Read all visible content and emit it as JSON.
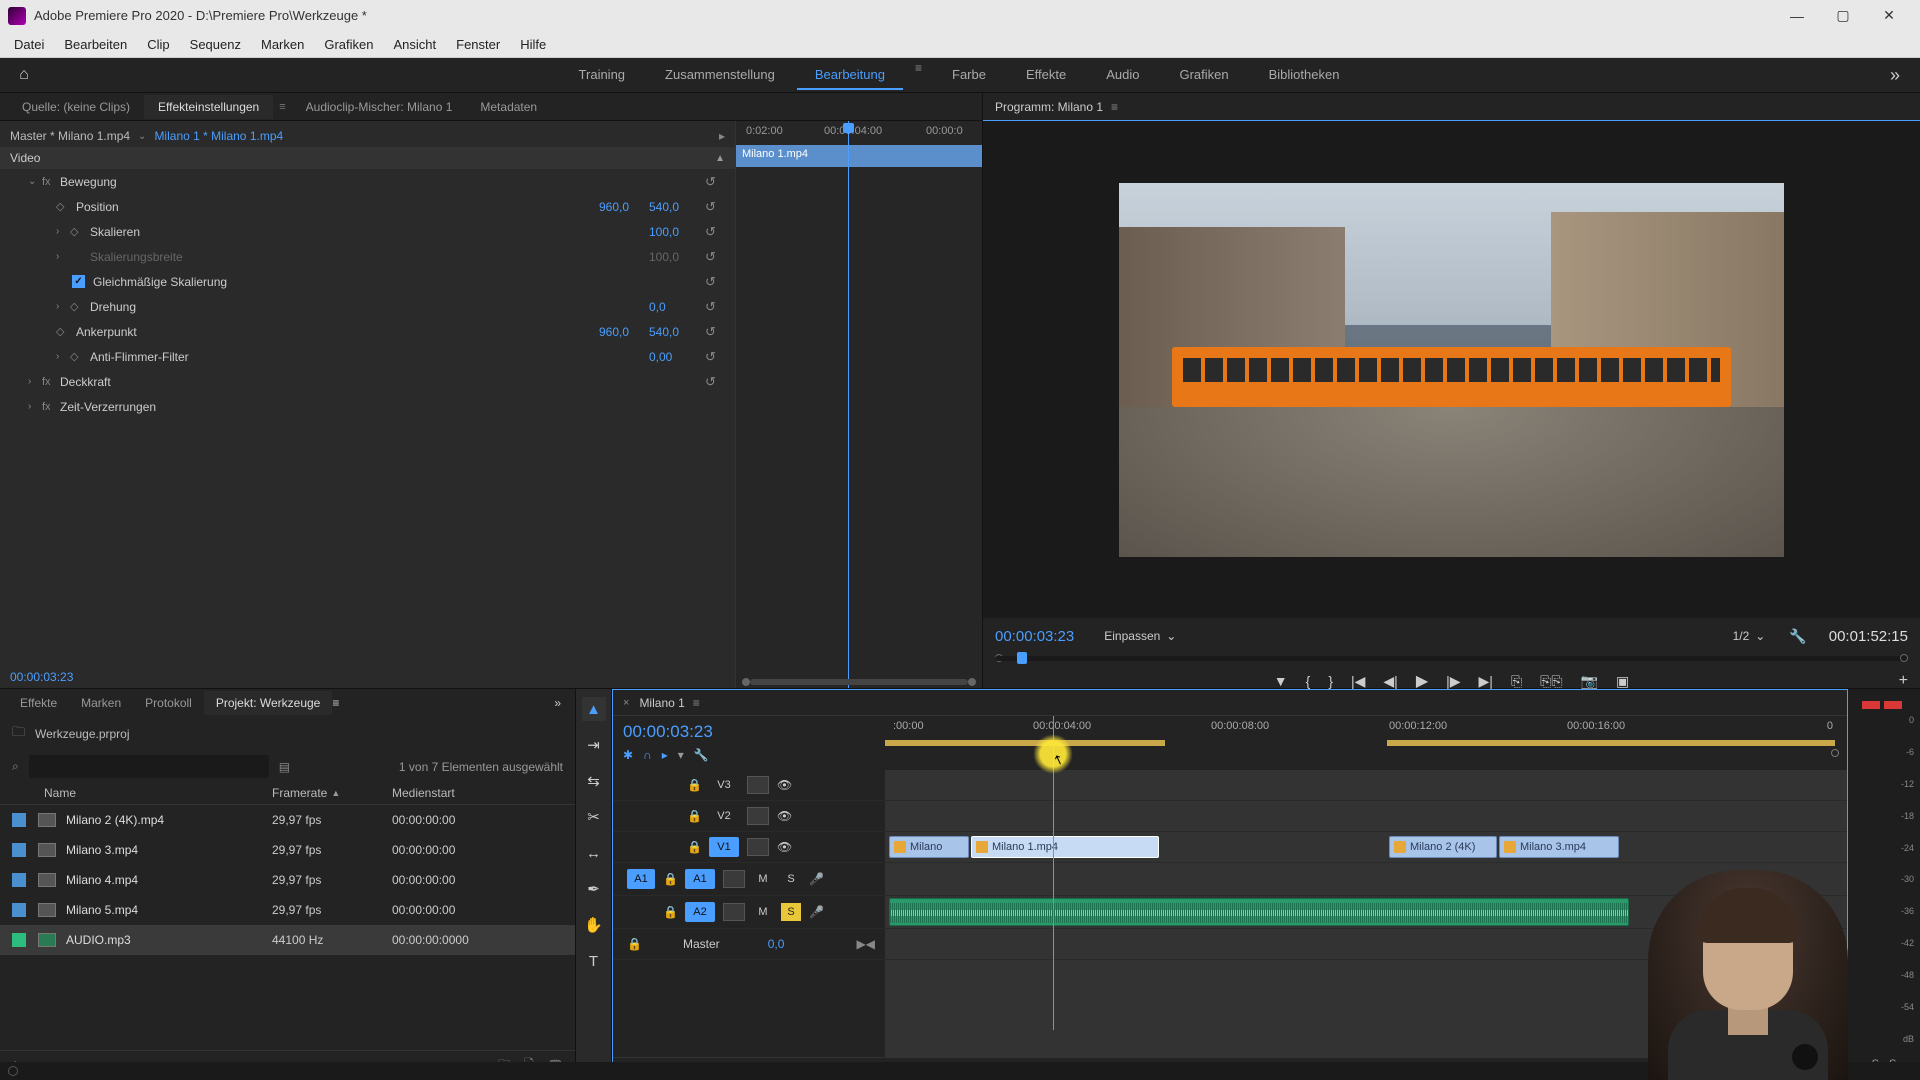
{
  "titlebar": {
    "app": "Adobe Premiere Pro 2020",
    "project_path": "D:\\Premiere Pro\\Werkzeuge *"
  },
  "menu": [
    "Datei",
    "Bearbeiten",
    "Clip",
    "Sequenz",
    "Marken",
    "Grafiken",
    "Ansicht",
    "Fenster",
    "Hilfe"
  ],
  "workspaces": {
    "tabs": [
      "Training",
      "Zusammenstellung",
      "Bearbeitung",
      "Farbe",
      "Effekte",
      "Audio",
      "Grafiken",
      "Bibliotheken"
    ],
    "active": "Bearbeitung"
  },
  "source_tabs": {
    "items": [
      "Quelle: (keine Clips)",
      "Effekteinstellungen",
      "Audioclip-Mischer: Milano 1",
      "Metadaten"
    ],
    "active": "Effekteinstellungen"
  },
  "effect_controls": {
    "master": "Master * Milano 1.mp4",
    "clipref": "Milano 1 * Milano 1.mp4",
    "section": "Video",
    "clip_label": "Milano 1.mp4",
    "ruler": [
      "0:02:00",
      "00:00:04:00",
      "00:00:0"
    ],
    "timecode": "00:00:03:23",
    "rows": {
      "bewegung": "Bewegung",
      "position": "Position",
      "pos_x": "960,0",
      "pos_y": "540,0",
      "skalieren": "Skalieren",
      "skal_v": "100,0",
      "skalbreite": "Skalierungsbreite",
      "skalb_v": "100,0",
      "gleich": "Gleichmäßige Skalierung",
      "drehung": "Drehung",
      "dreh_v": "0,0",
      "anker": "Ankerpunkt",
      "ank_x": "960,0",
      "ank_y": "540,0",
      "flimmer": "Anti-Flimmer-Filter",
      "flim_v": "0,00",
      "deckkraft": "Deckkraft",
      "zeit": "Zeit-Verzerrungen"
    }
  },
  "program": {
    "title": "Programm: Milano 1",
    "timecode": "00:00:03:23",
    "fit": "Einpassen",
    "resolution": "1/2",
    "duration": "00:01:52:15"
  },
  "project_panel": {
    "tabs": [
      "Effekte",
      "Marken",
      "Protokoll",
      "Projekt: Werkzeuge"
    ],
    "active": "Projekt: Werkzeuge",
    "filename": "Werkzeuge.prproj",
    "selection_info": "1 von 7 Elementen ausgewählt",
    "search_placeholder": "",
    "headers": {
      "name": "Name",
      "framerate": "Framerate",
      "mediastart": "Medienstart"
    },
    "items": [
      {
        "name": "Milano 2 (4K).mp4",
        "fr": "29,97 fps",
        "ms": "00:00:00:00",
        "type": "v"
      },
      {
        "name": "Milano 3.mp4",
        "fr": "29,97 fps",
        "ms": "00:00:00:00",
        "type": "v"
      },
      {
        "name": "Milano 4.mp4",
        "fr": "29,97 fps",
        "ms": "00:00:00:00",
        "type": "v"
      },
      {
        "name": "Milano 5.mp4",
        "fr": "29,97 fps",
        "ms": "00:00:00:00",
        "type": "v"
      },
      {
        "name": "AUDIO.mp3",
        "fr": "44100 Hz",
        "ms": "00:00:00:0000",
        "type": "a",
        "sel": true
      }
    ]
  },
  "timeline": {
    "seq_name": "Milano 1",
    "timecode": "00:00:03:23",
    "ruler": [
      ":00:00",
      "00:00:04:00",
      "00:00:08:00",
      "00:00:12:00",
      "00:00:16:00",
      "0"
    ],
    "tracks": {
      "v3": "V3",
      "v2": "V2",
      "v1": "V1",
      "a1": "A1",
      "a2": "A2",
      "master": "Master",
      "master_v": "0,0",
      "src_a1": "A1"
    },
    "clips": {
      "c1": "Milano",
      "c2": "Milano 1.mp4",
      "c3": "Milano 2 (4K)",
      "c4": "Milano 3.mp4"
    },
    "mute": "M",
    "solo": "S"
  },
  "meters": {
    "db": [
      "0",
      "-6",
      "-12",
      "-18",
      "-24",
      "-30",
      "-36",
      "-42",
      "-48",
      "-54",
      "dB"
    ],
    "s": "S"
  }
}
